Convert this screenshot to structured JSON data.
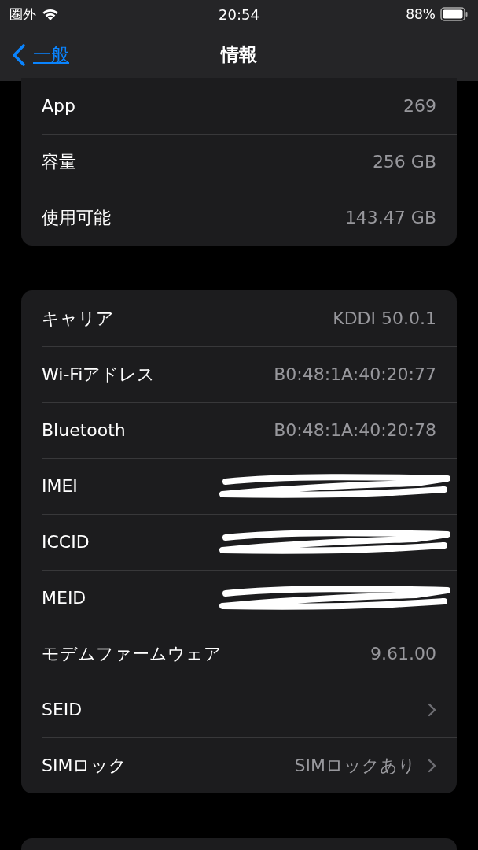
{
  "status_bar": {
    "carrier": "圏外",
    "time": "20:54",
    "battery": "88%"
  },
  "nav": {
    "back": "一般",
    "title": "情報"
  },
  "groups": [
    {
      "top_cut": true,
      "rows": [
        {
          "label": "App",
          "value": "269"
        },
        {
          "label": "容量",
          "value": "256 GB"
        },
        {
          "label": "使用可能",
          "value": "143.47 GB"
        }
      ]
    },
    {
      "top_cut": false,
      "rows": [
        {
          "label": "キャリア",
          "value": "KDDI 50.0.1"
        },
        {
          "label": "Wi-Fiアドレス",
          "value": "B0:48:1A:40:20:77"
        },
        {
          "label": "Bluetooth",
          "value": "B0:48:1A:40:20:78"
        },
        {
          "label": "IMEI",
          "redacted": true
        },
        {
          "label": "ICCID",
          "redacted": true
        },
        {
          "label": "MEID",
          "redacted": true
        },
        {
          "label": "モデムファームウェア",
          "value": "9.61.00"
        },
        {
          "label": "SEID",
          "disclosure": true
        },
        {
          "label": "SIMロック",
          "value": "SIMロックあり",
          "disclosure": true
        }
      ]
    },
    {
      "top_cut": false
    }
  ]
}
